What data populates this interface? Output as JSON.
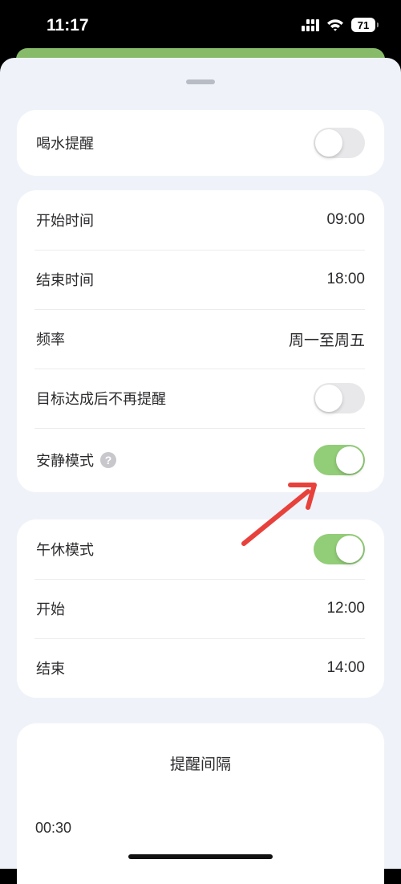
{
  "status_bar": {
    "time": "11:17",
    "battery": "71",
    "icons": [
      "signal-icon",
      "wifi-icon",
      "battery-icon"
    ]
  },
  "water_reminder": {
    "label": "喝水提醒",
    "enabled": false
  },
  "schedule": {
    "start_time_label": "开始时间",
    "start_time_value": "09:00",
    "end_time_label": "结束时间",
    "end_time_value": "18:00",
    "frequency_label": "频率",
    "frequency_value": "周一至周五",
    "stop_after_goal_label": "目标达成后不再提醒",
    "stop_after_goal_enabled": false,
    "quiet_mode_label": "安静模式",
    "quiet_mode_help": "?",
    "quiet_mode_enabled": true
  },
  "nap": {
    "label": "午休模式",
    "enabled": true,
    "start_label": "开始",
    "start_value": "12:00",
    "end_label": "结束",
    "end_value": "14:00"
  },
  "interval": {
    "title": "提醒间隔",
    "value": "00:30"
  },
  "colors": {
    "accent_green": "#92cd78",
    "header_green": "#87bb6a",
    "sheet_background": "#eff3f9",
    "annotation_arrow": "#e8413c"
  }
}
